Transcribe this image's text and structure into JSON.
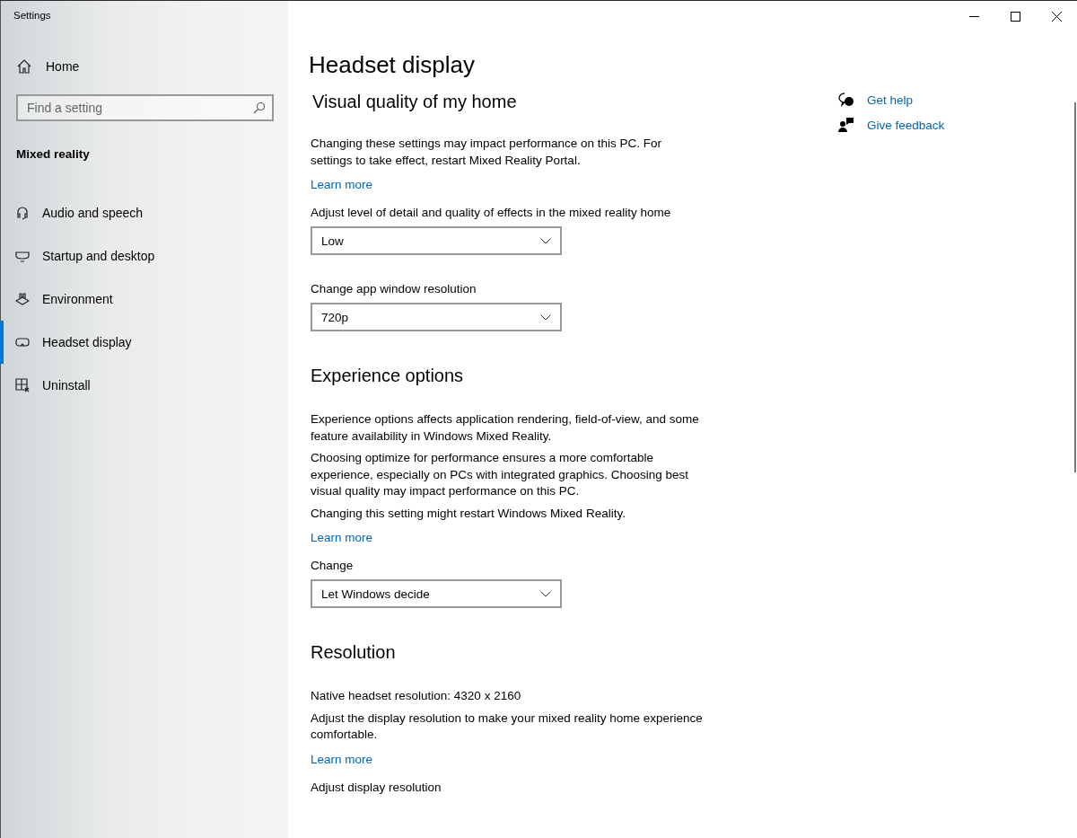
{
  "window": {
    "title": "Settings"
  },
  "sidebar": {
    "home": "Home",
    "search": {
      "placeholder": "Find a setting"
    },
    "heading": "Mixed reality",
    "items": [
      {
        "label": "Audio and speech",
        "selected": false
      },
      {
        "label": "Startup and desktop",
        "selected": false
      },
      {
        "label": "Environment",
        "selected": false
      },
      {
        "label": "Headset display",
        "selected": true
      },
      {
        "label": "Uninstall",
        "selected": false
      }
    ]
  },
  "main": {
    "title": "Headset display",
    "sections": [
      {
        "heading": "Visual quality of my home",
        "blocks": [
          {
            "kind": "text",
            "text": "Changing these settings may impact performance on this PC. For settings to take effect, restart Mixed Reality Portal."
          },
          {
            "kind": "link",
            "text": "Learn more"
          },
          {
            "kind": "label",
            "text": "Adjust level of detail and quality of effects in the mixed reality home"
          },
          {
            "kind": "dropdown",
            "value": "Low"
          },
          {
            "kind": "label",
            "text": "Change app window resolution"
          },
          {
            "kind": "dropdown",
            "value": "720p"
          }
        ]
      },
      {
        "heading": "Experience options",
        "blocks": [
          {
            "kind": "text",
            "text": "Experience options affects application rendering, field-of-view, and some feature availability in Windows Mixed Reality."
          },
          {
            "kind": "text",
            "text": "Choosing optimize for performance ensures a more comfortable experience, especially on PCs with integrated graphics. Choosing best visual quality may impact performance on this PC."
          },
          {
            "kind": "text",
            "text": "Changing this setting might restart Windows Mixed Reality."
          },
          {
            "kind": "link",
            "text": "Learn more"
          },
          {
            "kind": "label",
            "text": "Change"
          },
          {
            "kind": "dropdown",
            "value": "Let Windows decide"
          }
        ]
      },
      {
        "heading": "Resolution",
        "blocks": [
          {
            "kind": "text",
            "text": "Native headset resolution: 4320 x 2160"
          },
          {
            "kind": "text",
            "text": "Adjust the display resolution to make your mixed reality home experience comfortable."
          },
          {
            "kind": "link",
            "text": "Learn more"
          },
          {
            "kind": "label",
            "text": "Adjust display resolution"
          }
        ]
      }
    ]
  },
  "related": [
    {
      "label": "Get help"
    },
    {
      "label": "Give feedback"
    }
  ]
}
